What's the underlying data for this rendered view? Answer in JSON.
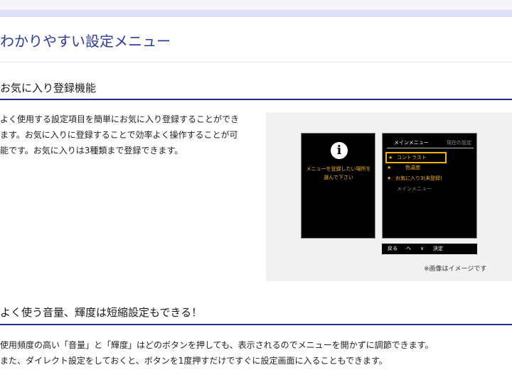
{
  "header": {
    "page_title": "わかりやすい設定メニュー"
  },
  "sections": [
    {
      "title": "お気に入り登録機能",
      "body_lines": [
        "よく使用する設定項目を簡単にお気に入り登録することができ",
        "ます。お気に入りに登録することで効率よく操作することが可",
        "能です。お気に入りは3種類まで登録できます。"
      ]
    },
    {
      "title": "よく使う音量、輝度は短縮設定もできる！",
      "body_lines": [
        "使用頻度の高い「音量」と「輝度」はどのボタンを押しても、表示されるのでメニューを開かずに調節できます。",
        "また、ダイレクト設定をしておくと、ボタンを1度押すだけですぐに設定画面に入ることもできます。"
      ]
    }
  ],
  "figure": {
    "left_screen": {
      "icon": "info-icon",
      "icon_glyph": "i",
      "prompt_lines": [
        "メニューを登録したい場所を",
        "選んで下さい"
      ]
    },
    "right_screen": {
      "header_main": "メインメニュー",
      "header_current": "現在の設定",
      "star_glyph": "★",
      "items": [
        {
          "label": "コントラスト",
          "starred": true,
          "selected": true
        },
        {
          "label": "色温度",
          "starred": true,
          "selected": false
        },
        {
          "label": "お気に入り3(未登録)",
          "starred": true,
          "selected": false
        },
        {
          "label": "メインメニュー",
          "starred": false,
          "selected": false
        }
      ]
    },
    "nav_bar": {
      "back": "戻る",
      "up": "へ",
      "down": "∨",
      "confirm": "決定"
    },
    "caption": "※画像はイメージです"
  },
  "colors": {
    "title_blue": "#2a3aa8",
    "rule_navy": "#1b2f86",
    "osd_amber": "#f2b400"
  }
}
